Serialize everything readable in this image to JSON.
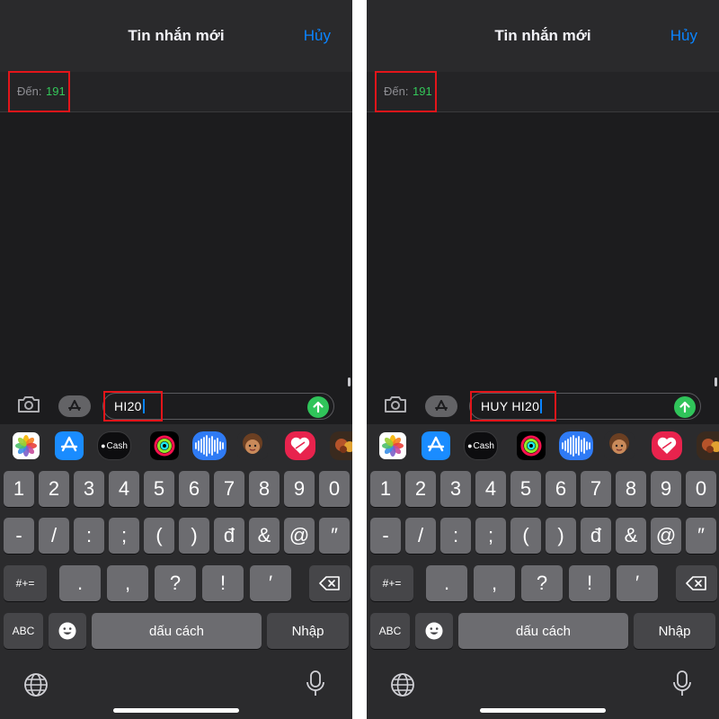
{
  "screens": [
    {
      "nav": {
        "title": "Tin nhắn mới",
        "cancel": "Hủy"
      },
      "to": {
        "label": "Đến:",
        "value": "191"
      },
      "message": {
        "text": "HI20"
      }
    },
    {
      "nav": {
        "title": "Tin nhắn mới",
        "cancel": "Hủy"
      },
      "to": {
        "label": "Đến:",
        "value": "191"
      },
      "message": {
        "text": "HUY HI20"
      }
    }
  ],
  "app_strip": [
    {
      "name": "photos-app-icon"
    },
    {
      "name": "app-store-icon"
    },
    {
      "name": "apple-cash-icon",
      "label": "Cash"
    },
    {
      "name": "activity-icon"
    },
    {
      "name": "audio-message-icon"
    },
    {
      "name": "memoji-icon"
    },
    {
      "name": "digital-touch-icon"
    },
    {
      "name": "stickers-icon"
    }
  ],
  "keyboard": {
    "row1": [
      "1",
      "2",
      "3",
      "4",
      "5",
      "6",
      "7",
      "8",
      "9",
      "0"
    ],
    "row2": [
      "-",
      "/",
      ":",
      ";",
      "(",
      ")",
      "đ",
      "&",
      "@",
      "″"
    ],
    "row3_left": "#+=",
    "row3": [
      ".",
      ",",
      "?",
      "!",
      "′"
    ],
    "abc": "ABC",
    "space": "dấu cách",
    "return": "Nhập"
  },
  "colors": {
    "accent_blue": "#0a84ff",
    "recipient_green": "#34c759",
    "send_green": "#30c45a",
    "highlight_red": "#e3151a",
    "background": "#1c1c1e",
    "keyboard_bg": "#2b2b2d",
    "key_light": "#6c6c70",
    "key_dark": "#464649"
  }
}
